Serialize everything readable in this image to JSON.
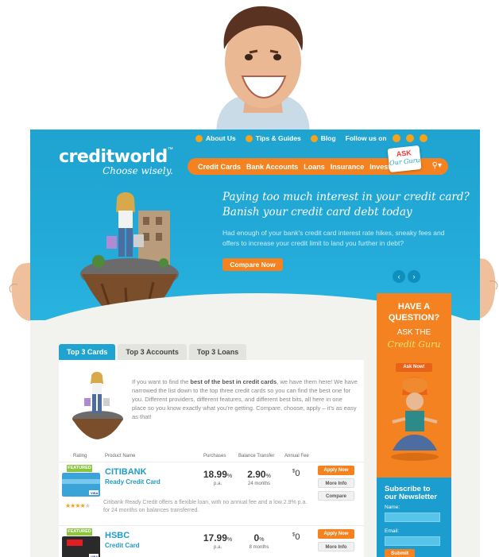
{
  "topnav": {
    "about": "About Us",
    "tips": "Tips & Guides",
    "blog": "Blog",
    "follow": "Follow us on"
  },
  "logo": {
    "name": "creditworld",
    "tm": "™",
    "tagline": "Choose wisely."
  },
  "mainnav": {
    "items": [
      "Credit Cards",
      "Bank Accounts",
      "Loans",
      "Insurance",
      "Invest"
    ],
    "search_icon": "search-icon"
  },
  "askbadge": {
    "line1": "ASK",
    "line2": "Our Guru"
  },
  "hero": {
    "headline_1": "Paying too much interest in your credit card?",
    "headline_2": "Banish your credit card debt today",
    "lead": "Had enough of your bank's credit card interest rate hikes, sneaky fees and offers to increase your credit limit to land you further in debt?",
    "cta": "Compare Now",
    "prev": "‹",
    "next": "›"
  },
  "tabs": [
    "Top 3 Cards",
    "Top 3 Accounts",
    "Top 3 Loans"
  ],
  "intro": {
    "p1": "If you want to find the ",
    "bold": "best of the best in credit cards",
    "p2": ", we have them here! We have narrowed the list down to the top three credit cards so you can find the best one for you. Different providers, different features, and different best bits, all here in one place so you know exactly what you're getting. Compare, choose, apply – it's as easy as that!"
  },
  "table_head": {
    "rating": "Rating",
    "product": "Product Name",
    "purchases": "Purchases",
    "balance": "Balance Transfer",
    "fee": "Annual Fee"
  },
  "cards": [
    {
      "badge": "FEATURED",
      "bank": "CITIBANK",
      "product": "Ready Credit Card",
      "purchase_rate": "18.99",
      "pct": "%",
      "purchase_sub": "p.a.",
      "bt_rate": "2.90",
      "bt_sub": "24 months",
      "fee_symbol": "$",
      "fee": "0",
      "apply": "Apply Now",
      "more": "More Info",
      "compare": "Compare",
      "stars": "★★★★",
      "star_off": "★",
      "desc": "Citibank Ready Credit offers a flexible loan, with no annual fee and a low 2.9% p.a. for 24 months on balances transferred."
    },
    {
      "badge": "FEATURED",
      "bank": "HSBC",
      "product": "Credit Card",
      "purchase_rate": "17.99",
      "pct": "%",
      "purchase_sub": "p.a.",
      "bt_rate": "0",
      "bt_sub": "8 months",
      "fee_symbol": "$",
      "fee": "0",
      "apply": "Apply Now",
      "more": "More Info"
    }
  ],
  "sidebar": {
    "have": "HAVE A",
    "question": "QUESTION?",
    "askthe": "ASK THE",
    "guru": "Credit Guru",
    "asknow": "Ask Now!",
    "subscribe_1": "Subscribe to",
    "subscribe_2": "our Newsletter",
    "name_label": "Name:",
    "email_label": "Email:",
    "submit": "Submit"
  },
  "colors": {
    "brand_blue": "#1fa3d0",
    "brand_orange": "#f58220",
    "featured_green": "#8cc63e"
  }
}
